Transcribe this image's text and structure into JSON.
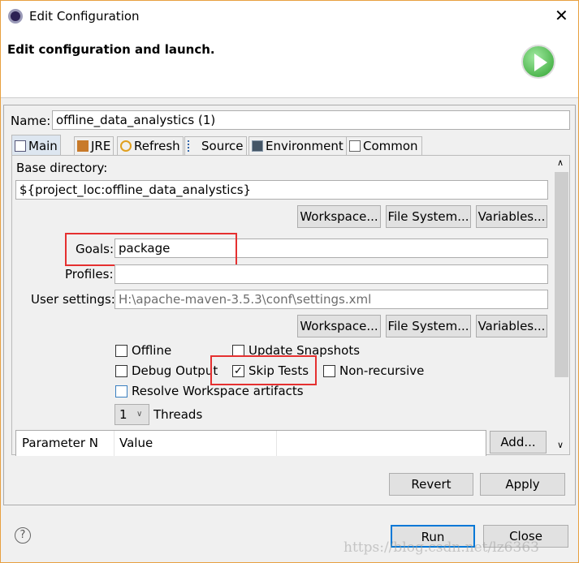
{
  "window": {
    "title": "Edit Configuration",
    "header": "Edit configuration and launch."
  },
  "name": {
    "label": "Name:",
    "value": "offline_data_analystics (1)"
  },
  "tabs": [
    {
      "label": "Main"
    },
    {
      "label": "JRE"
    },
    {
      "label": "Refresh"
    },
    {
      "label": "Source"
    },
    {
      "label": "Environment"
    },
    {
      "label": "Common"
    }
  ],
  "main": {
    "base_dir_label": "Base directory:",
    "base_dir_value": "${project_loc:offline_data_analystics}",
    "buttons1": [
      "Workspace...",
      "File System...",
      "Variables..."
    ],
    "goals_label": "Goals:",
    "goals_value": "package",
    "profiles_label": "Profiles:",
    "profiles_value": "",
    "user_settings_label": "User settings:",
    "user_settings_value": "H:\\apache-maven-3.5.3\\conf\\settings.xml",
    "buttons2": [
      "Workspace...",
      "File System...",
      "Variables..."
    ],
    "checkboxes": [
      {
        "label": "Offline",
        "checked": false
      },
      {
        "label": "Update Snapshots",
        "checked": false
      },
      {
        "label": "Debug Output",
        "checked": false
      },
      {
        "label": "Skip Tests",
        "checked": true
      },
      {
        "label": "Non-recursive",
        "checked": false
      },
      {
        "label": "Resolve Workspace artifacts",
        "checked": false
      }
    ],
    "threads_value": "1",
    "threads_label": "Threads",
    "table_headers": [
      "Parameter N",
      "Value"
    ],
    "add_label": "Add..."
  },
  "actions": {
    "revert": "Revert",
    "apply": "Apply",
    "run": "Run",
    "close": "Close"
  },
  "watermark": "https://blog.csdn.net/lz6363",
  "colors": {
    "highlight": "#e53030",
    "accent": "#0078d7"
  }
}
